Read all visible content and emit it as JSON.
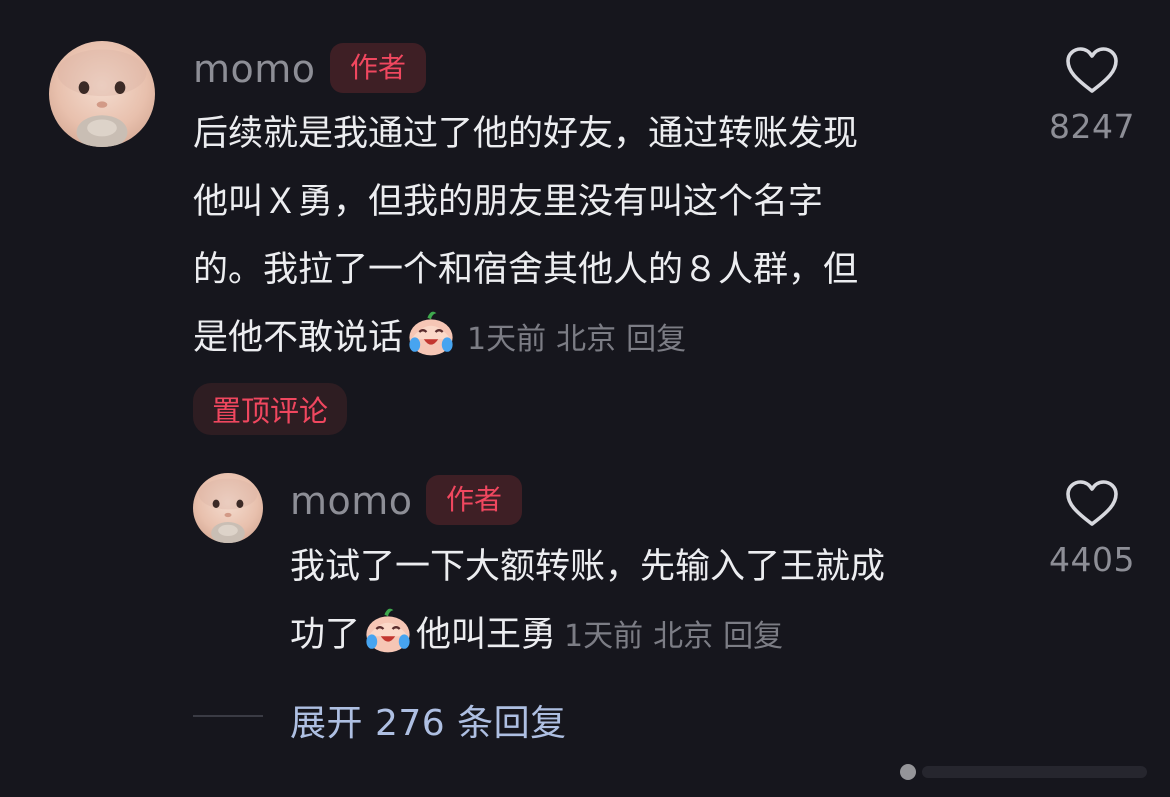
{
  "comments": [
    {
      "username": "momo",
      "badge": "作者",
      "lines": [
        "后续就是我通过了他的好友，通过转账发现",
        "他叫Ｘ勇，但我的朋友里没有叫这个名字",
        "的。我拉了一个和宿舍其他人的８人群，但",
        "是他不敢说话"
      ],
      "emoji": "crying-laughing-emoji",
      "time": "1天前",
      "location": "北京",
      "reply": "回复",
      "likes": "8247",
      "pinned_label": "置顶评论"
    }
  ],
  "reply": {
    "username": "momo",
    "badge": "作者",
    "line1": "我试了一下大额转账，先输入了王就成",
    "line2_before": "功了",
    "line2_after": "他叫王勇",
    "emoji": "crying-laughing-emoji",
    "time": "1天前",
    "location": "北京",
    "reply": "回复",
    "likes": "4405"
  },
  "expand_replies": "展开 276 条回复",
  "colors": {
    "background": "#16161d",
    "text": "#ecedf0",
    "muted": "#8d8e96",
    "accent_red": "#f0475f",
    "badge_bg": "#3e1f25",
    "expand_blue": "#aebfe2"
  }
}
